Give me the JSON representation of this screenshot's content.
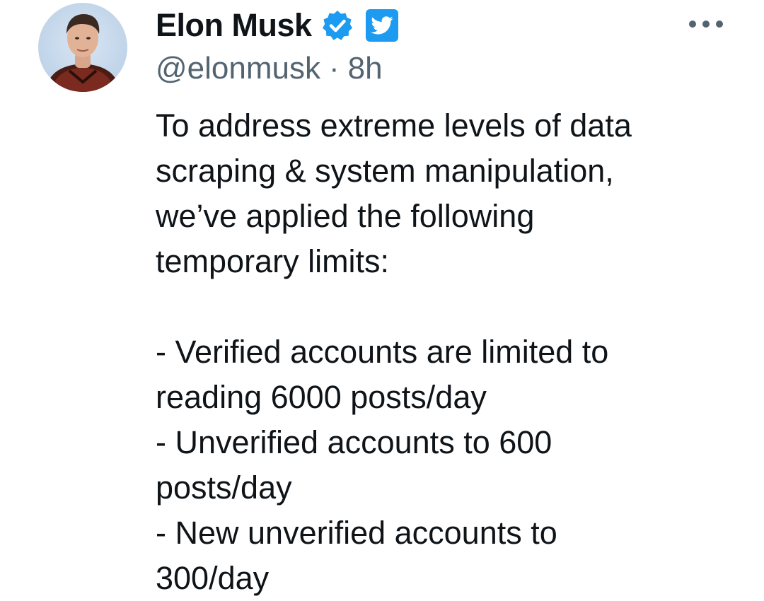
{
  "tweet": {
    "author": {
      "display_name": "Elon Musk",
      "handle": "@elonmusk",
      "avatar_icon": "profile-photo",
      "verified_icon": "verified-badge-icon",
      "affiliation_icon": "twitter-bird-icon"
    },
    "separator": "·",
    "timestamp": "8h",
    "more_icon": "more-options-icon",
    "text_lines": [
      "To address extreme levels of data",
      "scraping & system manipulation,",
      "we’ve applied the following",
      "temporary limits:",
      "",
      "- Verified accounts are limited to",
      "reading 6000 posts/day",
      "- Unverified accounts to 600",
      "posts/day",
      "- New unverified accounts to",
      "300/day"
    ]
  },
  "colors": {
    "text_primary": "#0f1419",
    "text_secondary": "#536471",
    "accent_blue": "#1d9bf0",
    "background": "#ffffff"
  }
}
